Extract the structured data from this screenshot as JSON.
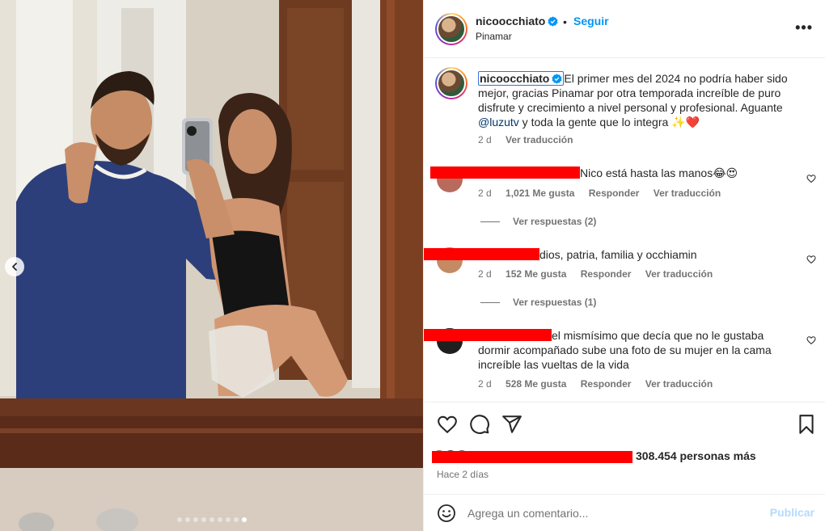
{
  "post": {
    "username": "nicoocchiato",
    "follow_label": "Seguir",
    "separator": "•",
    "location": "Pinamar",
    "more_label": "•••",
    "carousel": {
      "slide_count": 9,
      "active_index": 8
    }
  },
  "caption": {
    "username": "nicoocchiato",
    "text_before": "El primer mes del 2024 no podría haber sido mejor, gracias Pinamar por otra temporada increíble de puro disfrute y crecimiento a nivel personal y profesional. Aguante ",
    "mention": "@luzutv",
    "text_after": " y toda la gente que lo integra ✨❤️",
    "age": "2 d",
    "translate_label": "Ver traducción"
  },
  "comments": [
    {
      "text": "Nico está hasta las manos😂😍",
      "age": "2 d",
      "likes": "1,021 Me gusta",
      "reply_label": "Responder",
      "translate_label": "Ver traducción",
      "replies_label": "Ver respuestas (2)"
    },
    {
      "text": "dios, patria, familia y occhiamin",
      "age": "2 d",
      "likes": "152 Me gusta",
      "reply_label": "Responder",
      "translate_label": "Ver traducción",
      "replies_label": "Ver respuestas (1)"
    },
    {
      "text": "el mismísimo que decía que no le gustaba dormir acompañado sube una foto de su mujer en la cama increíble las vueltas de la vida",
      "age": "2 d",
      "likes": "528 Me gusta",
      "reply_label": "Responder",
      "translate_label": "Ver traducción"
    }
  ],
  "stats": {
    "likes_suffix": "308.454 personas más",
    "time": "Hace 2 días"
  },
  "add_comment": {
    "placeholder": "Agrega un comentario...",
    "publish_label": "Publicar"
  },
  "colors": {
    "accent": "#0095f6",
    "redaction": "#ff0000",
    "muted_text": "#737373",
    "publish_disabled": "#b3dbff"
  },
  "icons": [
    "verified-badge-icon",
    "chevron-left-icon",
    "heart-icon",
    "comment-icon",
    "share-icon",
    "bookmark-icon",
    "emoji-icon"
  ]
}
